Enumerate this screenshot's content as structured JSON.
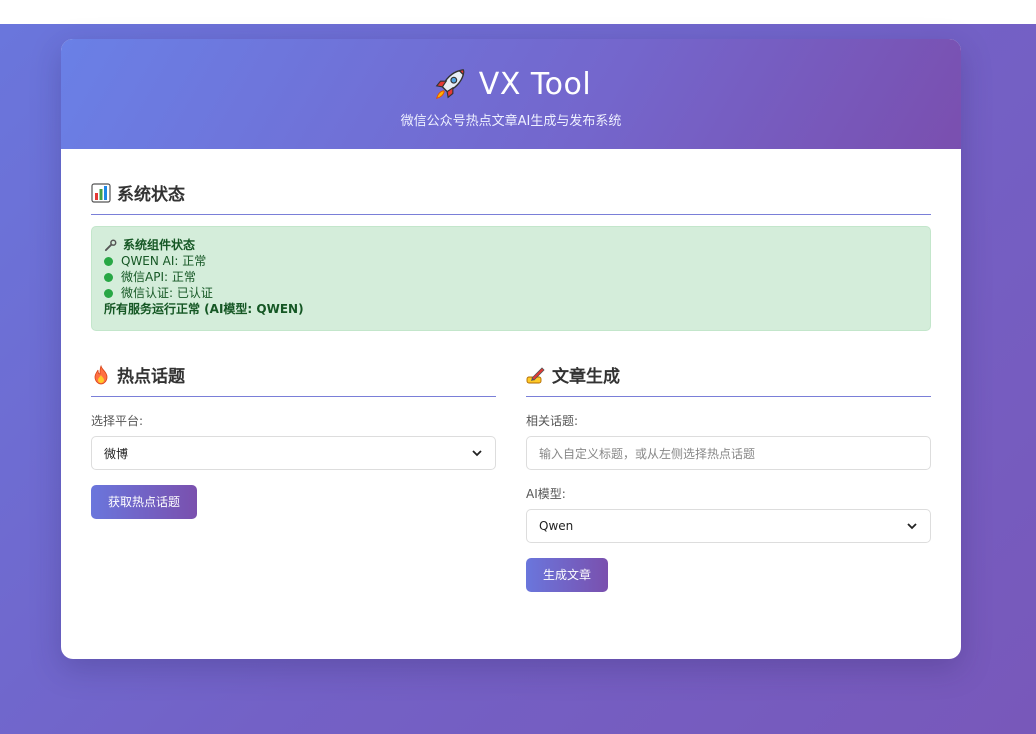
{
  "header": {
    "title": "VX Tool",
    "subtitle": "微信公众号热点文章AI生成与发布系统"
  },
  "status": {
    "section_title": "系统状态",
    "box_heading": "系统组件状态",
    "items": [
      "QWEN AI: 正常",
      "微信API: 正常",
      "微信认证: 已认证"
    ],
    "summary": "所有服务运行正常 (AI模型: QWEN)",
    "status_color": "#28a745"
  },
  "hot_topics": {
    "section_title": "热点话题",
    "platform_label": "选择平台:",
    "platform_selected": "微博",
    "fetch_button": "获取热点话题"
  },
  "article": {
    "section_title": "文章生成",
    "topic_label": "相关话题:",
    "topic_placeholder": "输入自定义标题，或从左侧选择热点话题",
    "model_label": "AI模型:",
    "model_selected": "Qwen",
    "generate_button": "生成文章"
  },
  "icons": [
    "rocket-icon",
    "bar-chart-icon",
    "wrench-icon",
    "fire-icon",
    "writing-hand-icon",
    "chevron-down-icon"
  ]
}
